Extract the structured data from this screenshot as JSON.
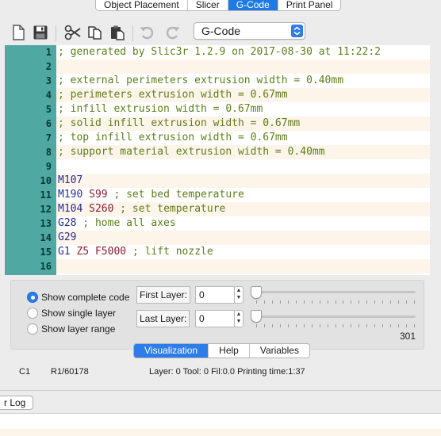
{
  "tabs": [
    {
      "label": "Object Placement",
      "active": false
    },
    {
      "label": "Slicer",
      "active": false
    },
    {
      "label": "G-Code",
      "active": true
    },
    {
      "label": "Print Panel",
      "active": false
    }
  ],
  "toolbar": {
    "icons": [
      "new-file-icon",
      "save-icon",
      "cut-icon",
      "copy-icon",
      "paste-icon",
      "undo-icon",
      "redo-icon"
    ],
    "language_select": "G-Code"
  },
  "editor": {
    "lines": [
      {
        "num": "1",
        "segments": [
          {
            "t": "; generated by Slic3r 1.2.9 on 2017-08-30 at 11:22:2",
            "c": "cmt"
          }
        ]
      },
      {
        "num": "2",
        "segments": []
      },
      {
        "num": "3",
        "segments": [
          {
            "t": "; external perimeters extrusion width = 0.40mm",
            "c": "cmt"
          }
        ]
      },
      {
        "num": "4",
        "segments": [
          {
            "t": "; perimeters extrusion width = 0.67mm",
            "c": "cmt"
          }
        ]
      },
      {
        "num": "5",
        "segments": [
          {
            "t": "; infill extrusion width = 0.67mm",
            "c": "cmt"
          }
        ]
      },
      {
        "num": "6",
        "segments": [
          {
            "t": "; solid infill extrusion width = 0.67mm",
            "c": "cmt"
          }
        ]
      },
      {
        "num": "7",
        "segments": [
          {
            "t": "; top infill extrusion width = 0.67mm",
            "c": "cmt"
          }
        ]
      },
      {
        "num": "8",
        "segments": [
          {
            "t": "; support material extrusion width = 0.40mm",
            "c": "cmt"
          }
        ]
      },
      {
        "num": "9",
        "segments": []
      },
      {
        "num": "10",
        "segments": [
          {
            "t": "M107",
            "c": "cmd"
          }
        ]
      },
      {
        "num": "11",
        "segments": [
          {
            "t": "M190 ",
            "c": "cmd"
          },
          {
            "t": "S99",
            "c": "prm"
          },
          {
            "t": " ; set bed temperature",
            "c": "cmt"
          }
        ]
      },
      {
        "num": "12",
        "segments": [
          {
            "t": "M104 ",
            "c": "cmd"
          },
          {
            "t": "S260",
            "c": "prm"
          },
          {
            "t": " ; set temperature",
            "c": "cmt"
          }
        ]
      },
      {
        "num": "13",
        "segments": [
          {
            "t": "G28",
            "c": "cmd"
          },
          {
            "t": " ; home all axes",
            "c": "cmt"
          }
        ]
      },
      {
        "num": "14",
        "segments": [
          {
            "t": "G29",
            "c": "cmd"
          }
        ]
      },
      {
        "num": "15",
        "segments": [
          {
            "t": "G1 ",
            "c": "cmd"
          },
          {
            "t": "Z5",
            "c": "prm"
          },
          {
            "t": " ",
            "c": "cmd"
          },
          {
            "t": "F5000",
            "c": "prm"
          },
          {
            "t": " ; lift nozzle",
            "c": "cmt"
          }
        ]
      },
      {
        "num": "16",
        "segments": []
      }
    ]
  },
  "layers": {
    "options": [
      {
        "label": "Show complete code",
        "selected": true
      },
      {
        "label": "Show single layer",
        "selected": false
      },
      {
        "label": "Show layer range",
        "selected": false
      }
    ],
    "first_layer_label": "First Layer:",
    "first_layer_value": "0",
    "last_layer_label": "Last Layer:",
    "last_layer_value": "0",
    "max_layer": "301"
  },
  "bottom_tabs": [
    {
      "label": "Visualization",
      "active": true
    },
    {
      "label": "Help",
      "active": false
    },
    {
      "label": "Variables",
      "active": false
    }
  ],
  "status": {
    "column": "C1",
    "row": "R1/60178",
    "info": "Layer: 0 Tool: 0 Fil:0.0 Printing time:1:37"
  },
  "log": {
    "button_label": "r Log"
  },
  "colors": {
    "accent": "#1f7ae4",
    "gutter": "#4fa8a2",
    "comment": "#5c7e1a",
    "command": "#2a2c91",
    "parameter": "#8e1b2f",
    "alt_row": "#fdf4ea"
  }
}
